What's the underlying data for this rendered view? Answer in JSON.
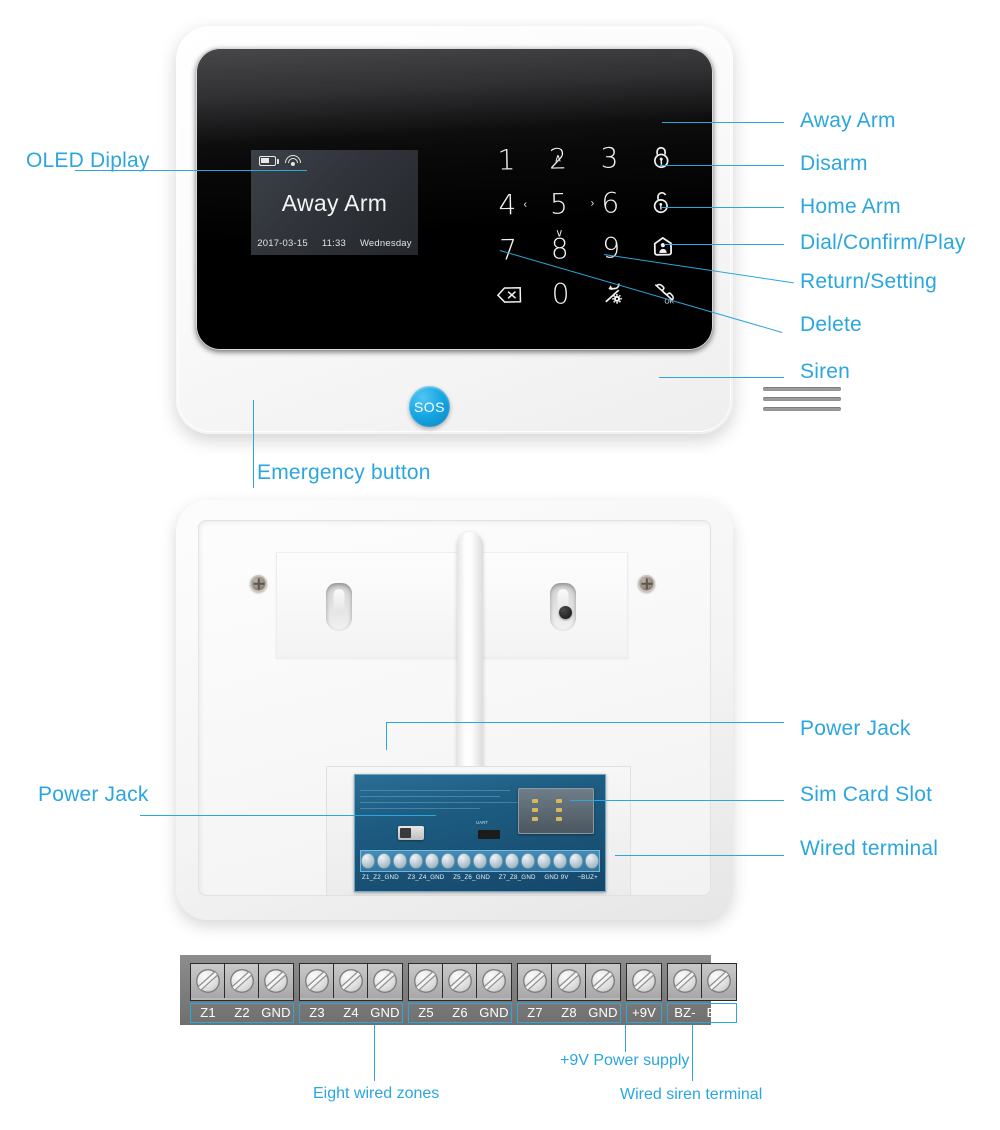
{
  "accent_color": "#2ba6de",
  "front_panel": {
    "oled": {
      "status_icons": [
        "battery-icon",
        "wifi-icon"
      ],
      "main_text": "Away Arm",
      "date": "2017-03-15",
      "time": "11:33",
      "weekday": "Wednesday"
    },
    "keypad": [
      {
        "name": "key-1",
        "label": "1",
        "arrow": ""
      },
      {
        "name": "key-2",
        "label": "2",
        "arrow": "∧"
      },
      {
        "name": "key-3",
        "label": "3",
        "arrow": ""
      },
      {
        "name": "key-away-arm",
        "label": "",
        "icon": "lock-closed-icon"
      },
      {
        "name": "key-4",
        "label": "4",
        "arrow": "‹"
      },
      {
        "name": "key-5",
        "label": "5",
        "arrow": ""
      },
      {
        "name": "key-6",
        "label": "6",
        "arrow": "›"
      },
      {
        "name": "key-disarm",
        "label": "",
        "icon": "lock-open-icon"
      },
      {
        "name": "key-7",
        "label": "7",
        "arrow": ""
      },
      {
        "name": "key-8",
        "label": "8",
        "arrow": "∨"
      },
      {
        "name": "key-9",
        "label": "9",
        "arrow": ""
      },
      {
        "name": "key-home-arm",
        "label": "",
        "icon": "home-person-icon"
      },
      {
        "name": "key-delete",
        "label": "",
        "icon": "backspace-icon"
      },
      {
        "name": "key-0",
        "label": "0",
        "arrow": ""
      },
      {
        "name": "key-return-setting",
        "label": "",
        "icon": "return-gear-icon"
      },
      {
        "name": "key-dial-confirm-play",
        "label": "",
        "icon": "phone-ok-icon"
      }
    ],
    "sos_button_label": "SOS",
    "callouts": {
      "oled_display": "OLED Diplay",
      "away_arm": "Away Arm",
      "disarm": "Disarm",
      "home_arm": "Home Arm",
      "dial_confirm_play": "Dial/Confirm/Play",
      "return_setting": "Return/Setting",
      "delete": "Delete",
      "siren": "Siren",
      "emergency_button": "Emergency button"
    }
  },
  "back_panel": {
    "pcb_terminal_labels": [
      "Z1_Z2_GND",
      "Z3_Z4_GND",
      "Z5_Z6_GND",
      "Z7_Z8_GND",
      "GND 9V",
      "−BUZ+"
    ],
    "callouts": {
      "power_jack_top": "Power Jack",
      "power_jack_left": "Power Jack",
      "sim_card_slot": "Sim Card Slot",
      "wired_terminal": "Wired terminal"
    }
  },
  "terminal_strip": {
    "groups": [
      {
        "labels": [
          "Z1",
          "Z2",
          "GND"
        ]
      },
      {
        "labels": [
          "Z3",
          "Z4",
          "GND"
        ]
      },
      {
        "labels": [
          "Z5",
          "Z6",
          "GND"
        ]
      },
      {
        "labels": [
          "Z7",
          "Z8",
          "GND"
        ]
      },
      {
        "labels": [
          "+9V"
        ]
      },
      {
        "labels": [
          "BZ-",
          "BZ+"
        ]
      }
    ],
    "captions": {
      "eight_wired_zones": "Eight wired zones",
      "power_supply": "+9V Power supply",
      "wired_siren_terminal": "Wired siren terminal"
    }
  }
}
